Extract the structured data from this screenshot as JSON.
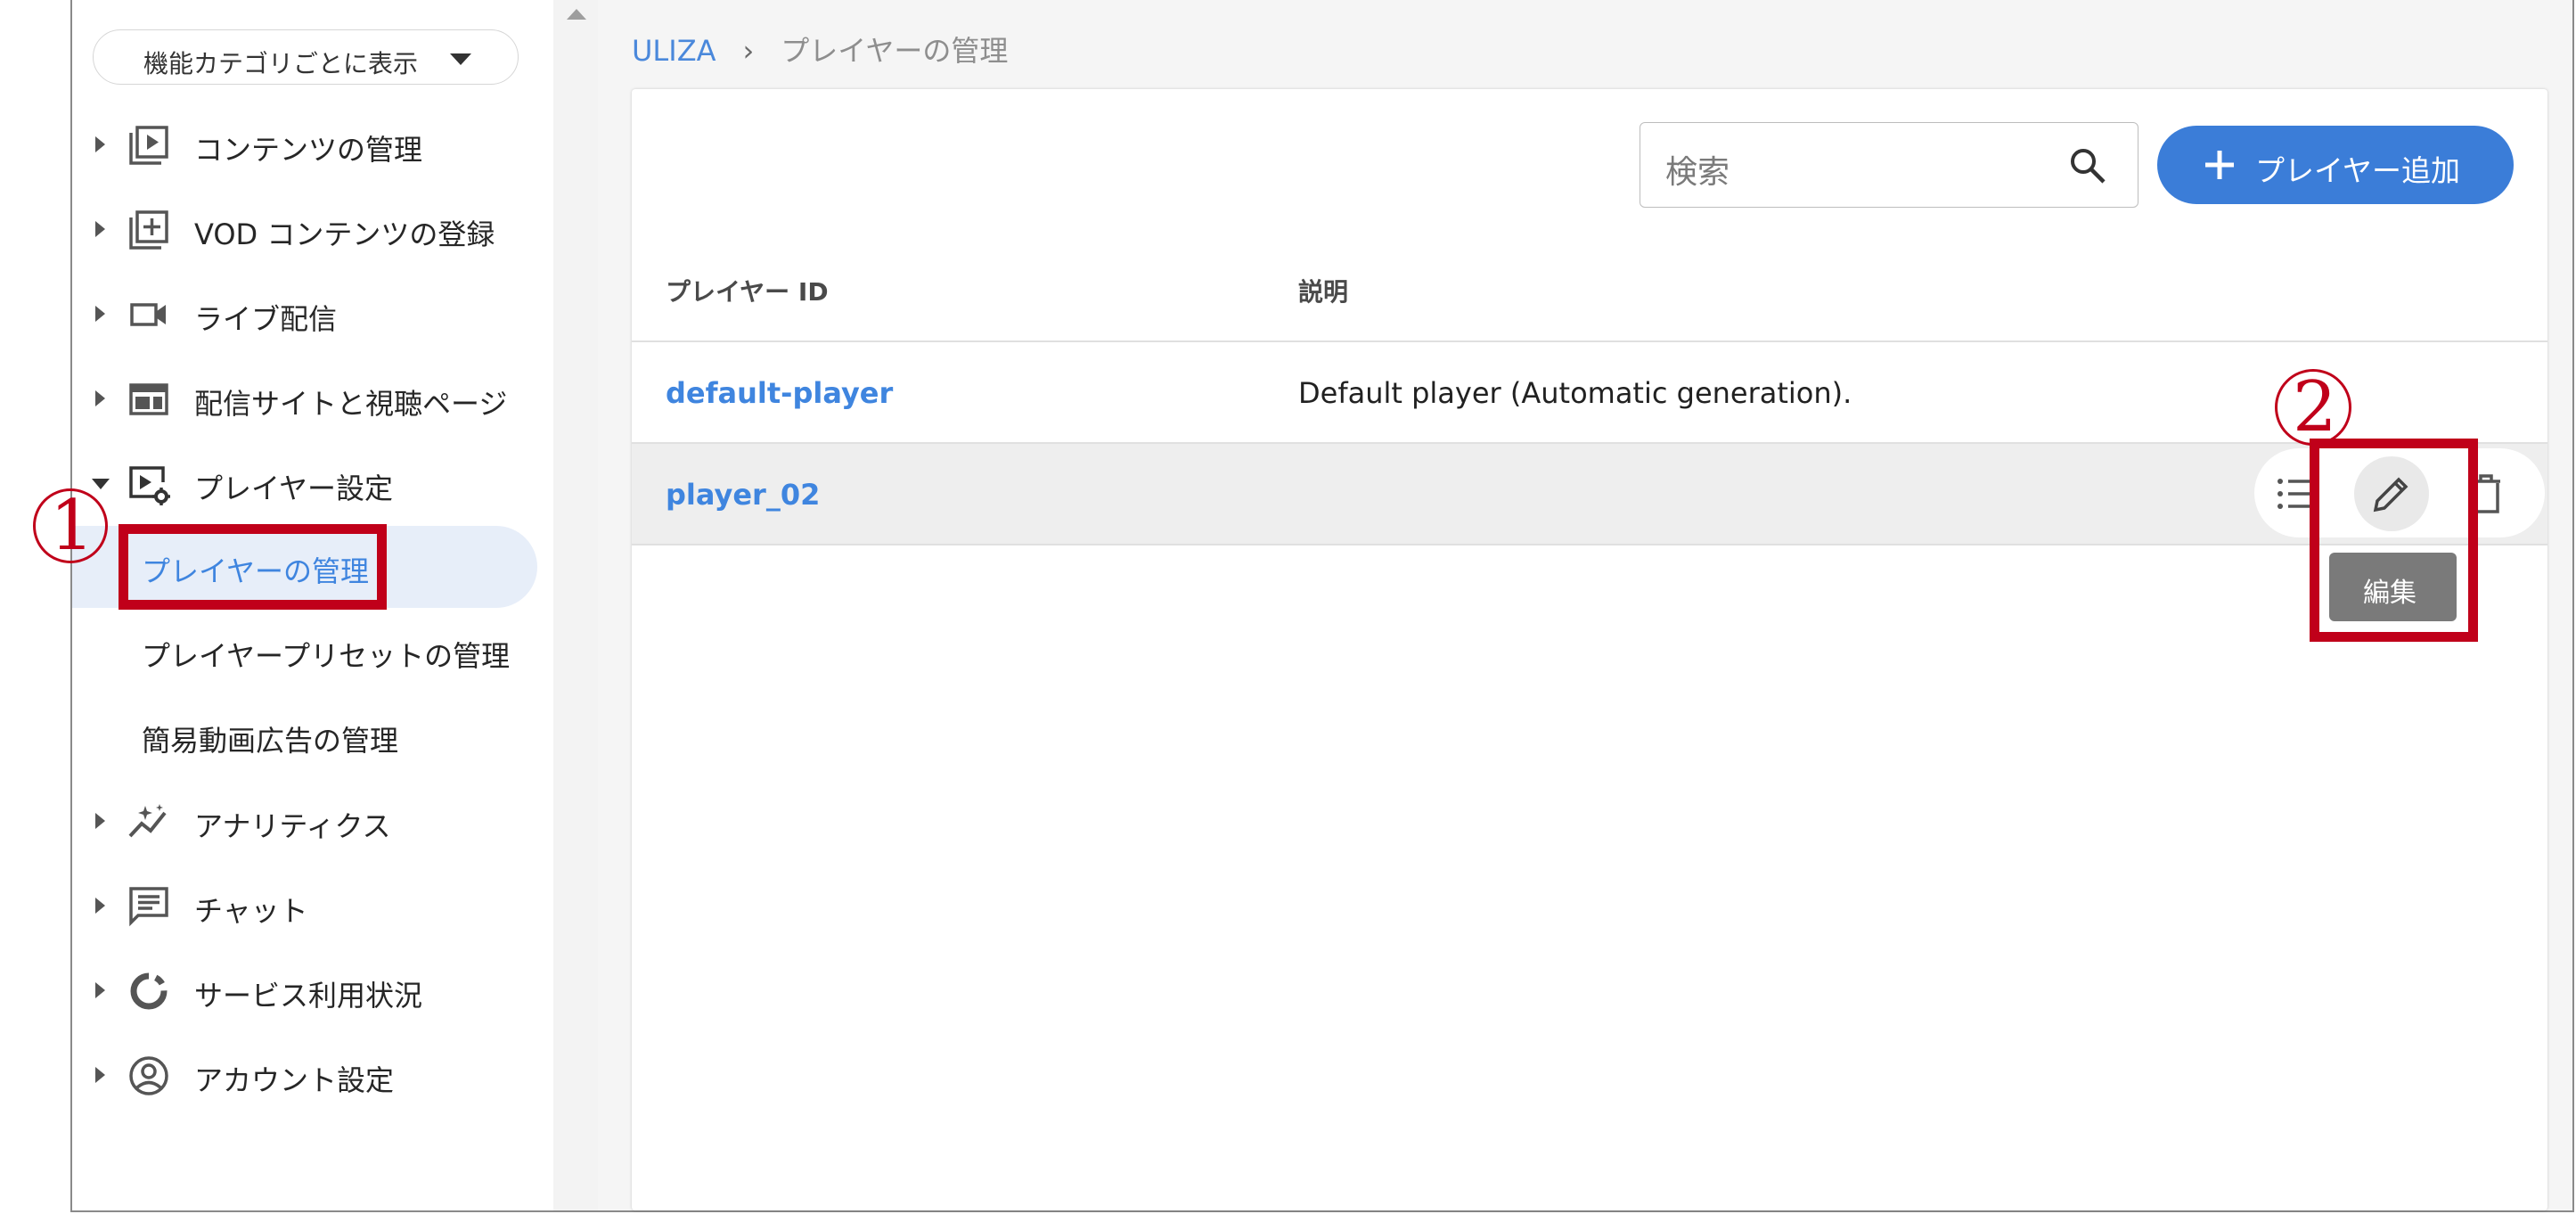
{
  "sidebar": {
    "category_select": {
      "label": "機能カテゴリごとに表示"
    },
    "items": [
      {
        "label": "コンテンツの管理",
        "icon": "video-library-icon"
      },
      {
        "label": "VOD コンテンツの登録",
        "icon": "add-box-icon"
      },
      {
        "label": "ライブ配信",
        "icon": "videocam-icon"
      },
      {
        "label": "配信サイトと視聴ページ",
        "icon": "web-layout-icon"
      },
      {
        "label": "プレイヤー設定",
        "icon": "player-settings-icon",
        "expanded": true
      },
      {
        "label": "アナリティクス",
        "icon": "analytics-icon"
      },
      {
        "label": "チャット",
        "icon": "chat-icon"
      },
      {
        "label": "サービス利用状況",
        "icon": "donut-icon"
      },
      {
        "label": "アカウント設定",
        "icon": "account-circle-icon"
      }
    ],
    "sub_items": [
      {
        "label": "プレイヤーの管理",
        "active": true
      },
      {
        "label": "プレイヤープリセットの管理"
      },
      {
        "label": "簡易動画広告の管理"
      }
    ]
  },
  "breadcrumb": {
    "root": "ULIZA",
    "separator": "›",
    "current": "プレイヤーの管理"
  },
  "toolbar": {
    "search_placeholder": "検索",
    "add_button": "プレイヤー追加"
  },
  "table": {
    "columns": [
      "プレイヤー ID",
      "説明"
    ],
    "rows": [
      {
        "id": "default-player",
        "description": "Default player (Automatic generation)."
      },
      {
        "id": "player_02",
        "description": ""
      }
    ]
  },
  "tooltip": {
    "text": "編集"
  },
  "annotations": {
    "step1": "1",
    "step2": "2",
    "color": "#c0001a"
  },
  "colors": {
    "accent": "#3b7dd8",
    "link": "#3f85df",
    "active_bg": "#e7eef9"
  }
}
